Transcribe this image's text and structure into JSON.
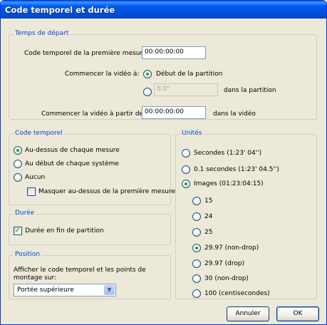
{
  "window": {
    "title": "Code temporel et durée"
  },
  "start_time": {
    "legend": "Temps de départ",
    "first_bar_label": "Code temporel de la première mesure",
    "first_bar_value": "00:00:00:00",
    "start_video_label": "Commencer la vidéo à:",
    "option_score_start": "Début de la partition",
    "offset_value": "0.0\"",
    "offset_suffix": "dans la partition",
    "start_from_label": "Commencer la vidéo à partir de:",
    "start_from_value": "00:00:00:00",
    "start_from_suffix": "dans la vidéo"
  },
  "timecode": {
    "legend": "Code temporel",
    "options": [
      "Au-dessus de chaque mesure",
      "Au début de chaque système",
      "Aucun"
    ],
    "selected_index": 0,
    "hide_first_label": "Masquer au-dessus de la première mesure",
    "hide_first_checked": false
  },
  "duration": {
    "legend": "Durée",
    "end_label": "Durée en fin de partition",
    "end_checked": true
  },
  "position": {
    "legend": "Position",
    "description": "Afficher le code temporel et les points de montage sur:",
    "select_value": "Portée supérieure"
  },
  "units": {
    "legend": "Unités",
    "options": [
      "Secondes (1:23' 04'')",
      "0.1 secondes (1:23' 04.5'')",
      "Images (01:23:04:15)"
    ],
    "selected_index": 2,
    "frame_rates": [
      "15",
      "24",
      "25",
      "29.97 (non-drop)",
      "29.97 (drop)",
      "30 (non-drop)",
      "100 (centisecondes)"
    ],
    "frame_selected_index": 3
  },
  "buttons": {
    "cancel": "Annuler",
    "ok": "OK"
  }
}
